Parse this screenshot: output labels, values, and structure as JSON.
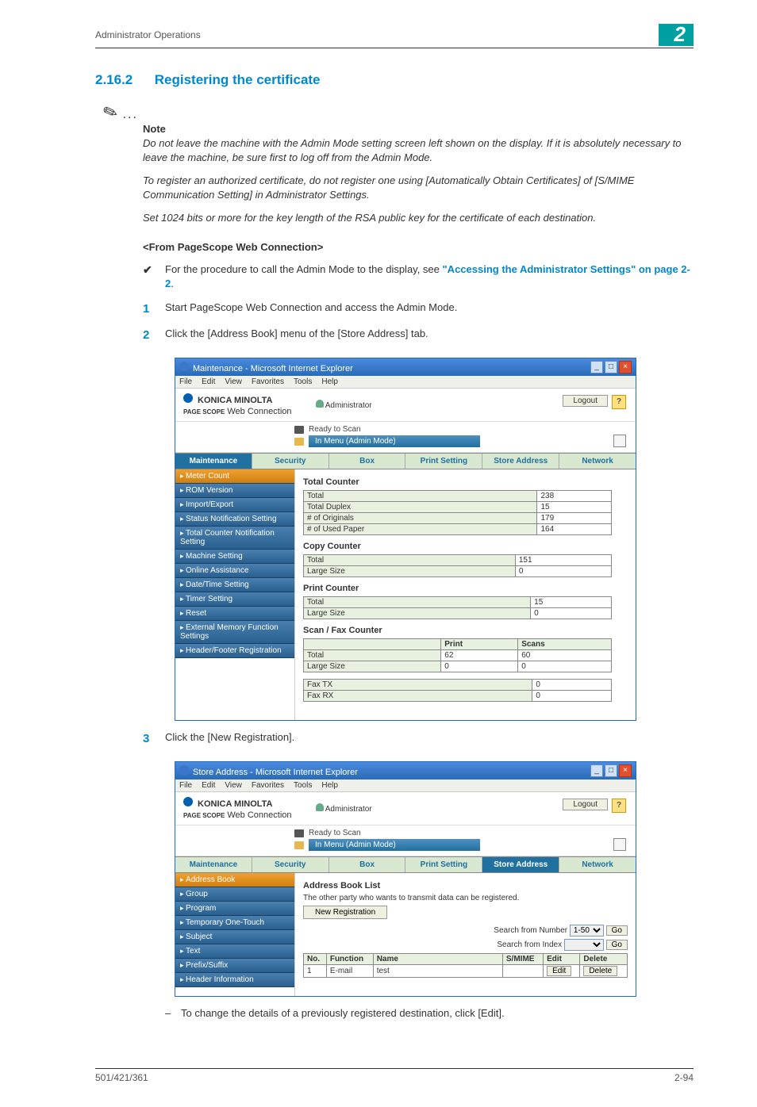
{
  "header": {
    "breadcrumb": "Administrator Operations",
    "chapter": "2"
  },
  "section": {
    "number": "2.16.2",
    "title": "Registering the certificate"
  },
  "note": {
    "label": "Note",
    "p1": "Do not leave the machine with the Admin Mode setting screen left shown on the display. If it is absolutely necessary to leave the machine, be sure first to log off from the Admin Mode.",
    "p2": "To register an authorized certificate, do not register one using [Automatically Obtain Certificates] of [S/MIME Communication Setting] in Administrator Settings.",
    "p3": "Set 1024 bits or more for the key length of the RSA public key for the certificate of each destination."
  },
  "subhead": "<From PageScope Web Connection>",
  "bullet": {
    "text": "For the procedure to call the Admin Mode to the display, see ",
    "link": "\"Accessing the Administrator Settings\" on page 2-2",
    "suffix": "."
  },
  "step1": "Start PageScope Web Connection and access the Admin Mode.",
  "step2": "Click the [Address Book] menu of the [Store Address] tab.",
  "step3": "Click the [New Registration].",
  "post3": "To change the details of a previously registered destination, click [Edit].",
  "footer": {
    "left": "501/421/361",
    "right": "2-94"
  },
  "win_common": {
    "menus": {
      "file": "File",
      "edit": "Edit",
      "view": "View",
      "fav": "Favorites",
      "tools": "Tools",
      "help": "Help"
    },
    "brand": "KONICA MINOLTA",
    "webc_prefix": "PAGE SCOPE",
    "webc": "Web Connection",
    "admin": "Administrator",
    "logout": "Logout",
    "help": "?",
    "ready": "Ready to Scan",
    "mode": "In Menu (Admin Mode)",
    "tabs": {
      "maint": "Maintenance",
      "sec": "Security",
      "box": "Box",
      "print": "Print Setting",
      "store": "Store Address",
      "net": "Network"
    }
  },
  "win1": {
    "title": "Maintenance - Microsoft Internet Explorer",
    "side": [
      "Meter Count",
      "ROM Version",
      "Import/Export",
      "Status Notification Setting",
      "Total Counter Notification Setting",
      "Machine Setting",
      "Online Assistance",
      "Date/Time Setting",
      "Timer Setting",
      "Reset",
      "External Memory Function Settings",
      "Header/Footer Registration"
    ],
    "total_counter": {
      "title": "Total Counter",
      "rows": [
        {
          "label": "Total",
          "val": "238"
        },
        {
          "label": "Total Duplex",
          "val": "15"
        },
        {
          "label": "# of Originals",
          "val": "179"
        },
        {
          "label": "# of Used Paper",
          "val": "164"
        }
      ]
    },
    "copy_counter": {
      "title": "Copy Counter",
      "rows": [
        {
          "label": "Total",
          "val": "151"
        },
        {
          "label": "Large Size",
          "val": "0"
        }
      ]
    },
    "print_counter": {
      "title": "Print Counter",
      "rows": [
        {
          "label": "Total",
          "val": "15"
        },
        {
          "label": "Large Size",
          "val": "0"
        }
      ]
    },
    "scanfax": {
      "title": "Scan / Fax Counter",
      "h1": "Print",
      "h2": "Scans",
      "rows": [
        {
          "label": "Total",
          "v1": "62",
          "v2": "60"
        },
        {
          "label": "Large Size",
          "v1": "0",
          "v2": "0"
        }
      ],
      "tx": {
        "label": "Fax TX",
        "val": "0"
      },
      "rx": {
        "label": "Fax RX",
        "val": "0"
      }
    }
  },
  "win2": {
    "title": "Store Address - Microsoft Internet Explorer",
    "side": [
      "Address Book",
      "Group",
      "Program",
      "Temporary One-Touch",
      "Subject",
      "Text",
      "Prefix/Suffix",
      "Header Information"
    ],
    "main_title": "Address Book List",
    "desc": "The other party who wants to transmit data can be registered.",
    "newreg": "New Registration",
    "search_num": "Search from Number",
    "range": "1-50",
    "go": "Go",
    "search_idx": "Search from Index",
    "cols": {
      "no": "No.",
      "func": "Function",
      "name": "Name",
      "smime": "S/MIME",
      "edit": "Edit",
      "del": "Delete"
    },
    "row": {
      "no": "1",
      "func": "E-mail",
      "name": "test",
      "smime": "",
      "edit": "Edit",
      "del": "Delete"
    }
  }
}
